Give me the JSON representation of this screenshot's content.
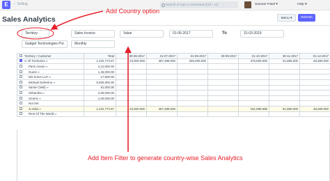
{
  "topbar": {
    "logo": "E",
    "breadcrumb": "Selling",
    "search_placeholder": "Search or type a command (Ctrl + G)",
    "user": "Sameer Patel",
    "help": "Help"
  },
  "page": {
    "title": "Sales Analytics",
    "menu_label": "Menu",
    "refresh_label": "Refresh"
  },
  "filters": {
    "tree_type": "Territory",
    "doc_type": "Sales Invoice",
    "value_quantity": "Value",
    "from_date": "01-06-2017",
    "to_label": "To",
    "to_date": "31-03-2019",
    "company": "Gadget Technologies Pvt.",
    "range": "Monthly"
  },
  "annotations": {
    "top": "Add Country option",
    "bottom": "Add Item Filter to generate country-wise Sales Analytics"
  },
  "table": {
    "columns": [
      "Territory / Customer",
      "Total",
      "30-06-2017",
      "31-07-2017",
      "31-08-2017",
      "30-09-2017",
      "31-10-2017",
      "30-11-2017",
      "31-12-2017"
    ],
    "rows": [
      {
        "name": "All Territories",
        "total": "1,422,772.67",
        "values": [
          "23,000.000",
          "467,499.000",
          "346,000.000",
          "",
          "276,600.000",
          "61,695.000",
          "48,280.000"
        ],
        "checked": true,
        "level": 0,
        "link": true
      },
      {
        "name": "Paris Ansari",
        "total": "2,21,000.00",
        "values": [
          "",
          "",
          "",
          "",
          "",
          "",
          ""
        ],
        "checked": false,
        "level": 1,
        "link": true
      },
      {
        "name": "Guest",
        "total": "1,45,000.00",
        "values": [
          "",
          "",
          "",
          "",
          "",
          "",
          ""
        ],
        "checked": false,
        "level": 1,
        "link": true
      },
      {
        "name": "Mic kores LLP",
        "total": "17,500.00",
        "values": [
          "",
          "",
          "",
          "",
          "",
          "",
          ""
        ],
        "checked": false,
        "level": 1,
        "link": true
      },
      {
        "name": "Michael Doherine",
        "total": "8,000,000.00",
        "values": [
          "",
          "",
          "",
          "",
          "",
          "",
          ""
        ],
        "checked": false,
        "level": 1,
        "link": true
      },
      {
        "name": "Samer (Nell)",
        "total": "81,000.00",
        "values": [
          "",
          "",
          "",
          "",
          "",
          "",
          ""
        ],
        "checked": false,
        "level": 1,
        "link": true
      },
      {
        "name": "Sriharsha",
        "total": "2,00,000.00",
        "values": [
          "",
          "",
          "",
          "",
          "",
          "",
          ""
        ],
        "checked": false,
        "level": 1,
        "link": true
      },
      {
        "name": "Umeric",
        "total": "1,00,000.00",
        "values": [
          "",
          "",
          "",
          "",
          "",
          "",
          ""
        ],
        "checked": false,
        "level": 1,
        "link": true
      },
      {
        "name": "Not Set",
        "total": "",
        "values": [
          "",
          "",
          "",
          "",
          "",
          "",
          ""
        ],
        "checked": false,
        "level": 1,
        "link": false
      },
      {
        "name": "India",
        "total": "1,422,772.67",
        "values": [
          "23,000.000",
          "467,499.000",
          "",
          "",
          "191,999.998",
          "61,695.000",
          "48,280.000"
        ],
        "checked": false,
        "level": 1,
        "link": true,
        "highlight": true
      },
      {
        "name": "Rest Of The World",
        "total": "",
        "values": [
          "",
          "",
          "",
          "",
          "",
          "",
          ""
        ],
        "checked": false,
        "level": 1,
        "link": true
      }
    ]
  },
  "colors": {
    "accent": "#5e64ff",
    "annotation": "#e7202a"
  }
}
